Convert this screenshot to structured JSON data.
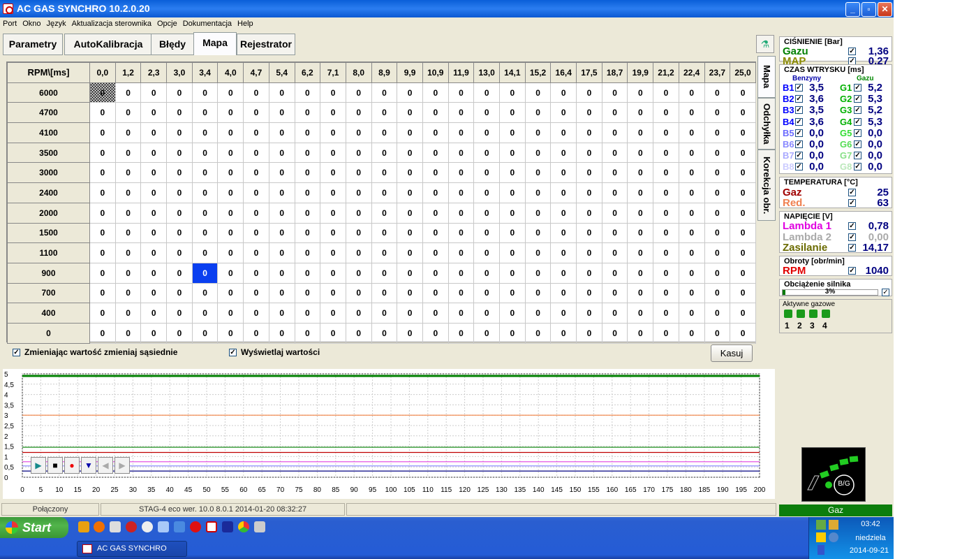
{
  "window": {
    "title": "AC GAS SYNCHRO  10.2.0.20",
    "minimize": "_",
    "maximize": "▫",
    "close": "✕"
  },
  "menu": [
    "Port",
    "Okno",
    "Język",
    "Aktualizacja sterownika",
    "Opcje",
    "Dokumentacja",
    "Help"
  ],
  "tabs": [
    "Parametry",
    "AutoKalibracja",
    "Błędy",
    "Mapa",
    "Rejestrator"
  ],
  "active_tab": "Mapa",
  "side_tabs": [
    "Mapa",
    "Odchyłka",
    "Korekcja obr."
  ],
  "map": {
    "corner": "RPM\\[ms]",
    "columns": [
      "0,0",
      "1,2",
      "2,3",
      "3,0",
      "3,4",
      "4,0",
      "4,7",
      "5,4",
      "6,2",
      "7,1",
      "8,0",
      "8,9",
      "9,9",
      "10,9",
      "11,9",
      "13,0",
      "14,1",
      "15,2",
      "16,4",
      "17,5",
      "18,7",
      "19,9",
      "21,2",
      "22,4",
      "23,7",
      "25,0"
    ],
    "rows": [
      "6000",
      "4700",
      "4100",
      "3500",
      "3000",
      "2400",
      "2000",
      "1500",
      "1100",
      "900",
      "700",
      "400",
      "0"
    ],
    "value": "0",
    "selected": {
      "row": 9,
      "col": 4
    },
    "hatched": {
      "row": 0,
      "col": 0
    }
  },
  "options": {
    "change_neighbors": "Zmieniając wartość zmieniaj sąsiednie",
    "show_values": "Wyświetlaj wartości",
    "clear": "Kasuj",
    "check": "✓"
  },
  "chart": {
    "y_ticks": [
      "5",
      "4,5",
      "4",
      "3,5",
      "3",
      "2,5",
      "2",
      "1,5",
      "1",
      "0,5",
      "0"
    ],
    "x_ticks": [
      "0",
      "5",
      "10",
      "15",
      "20",
      "25",
      "30",
      "35",
      "40",
      "45",
      "50",
      "55",
      "60",
      "65",
      "70",
      "75",
      "80",
      "85",
      "90",
      "95",
      "100",
      "105",
      "110",
      "115",
      "120",
      "125",
      "130",
      "135",
      "140",
      "145",
      "150",
      "155",
      "160",
      "165",
      "170",
      "175",
      "180",
      "185",
      "190",
      "195",
      "200"
    ],
    "series_colors": [
      "#008000",
      "#f08040",
      "#008000",
      "#c00000",
      "#e040e0",
      "#9090ff",
      "#000080"
    ],
    "series_levels": [
      4.9,
      3.0,
      1.45,
      1.2,
      0.75,
      0.55,
      0.3
    ]
  },
  "chart_controls": {
    "play": "▶",
    "stop": "■",
    "record": "●",
    "down": "▼",
    "prev": "◀",
    "next": "▶"
  },
  "status": {
    "connection": "Połączony",
    "device": "STAG-4 eco   wer. 10.0  8.0.1    2014-01-20 08:32:27"
  },
  "pressure": {
    "title": "CIŚNIENIE  [Bar]",
    "gas_label": "Gazu",
    "gas_value": "1,36",
    "map_label": "MAP",
    "map_value": "0,27"
  },
  "injection": {
    "title": "CZAS WTRYSKU  [ms]",
    "petrol_header": "Benzyny",
    "gas_header": "Gazu",
    "petrol": [
      {
        "l": "B1",
        "v": "3,5"
      },
      {
        "l": "B2",
        "v": "3,6"
      },
      {
        "l": "B3",
        "v": "3,5"
      },
      {
        "l": "B4",
        "v": "3,6"
      },
      {
        "l": "B5",
        "v": "0,0"
      },
      {
        "l": "B6",
        "v": "0,0"
      },
      {
        "l": "B7",
        "v": "0,0"
      },
      {
        "l": "B8",
        "v": "0,0"
      }
    ],
    "gas": [
      {
        "l": "G1",
        "v": "5,2"
      },
      {
        "l": "G2",
        "v": "5,3"
      },
      {
        "l": "G3",
        "v": "5,2"
      },
      {
        "l": "G4",
        "v": "5,3"
      },
      {
        "l": "G5",
        "v": "0,0"
      },
      {
        "l": "G6",
        "v": "0,0"
      },
      {
        "l": "G7",
        "v": "0,0"
      },
      {
        "l": "G8",
        "v": "0,0"
      }
    ]
  },
  "temperature": {
    "title": "TEMPERATURA  [°C]",
    "gas_label": "Gaz",
    "gas_value": "25",
    "red_label": "Red.",
    "red_value": "63"
  },
  "voltage": {
    "title": "NAPIĘCIE [V]",
    "l1_label": "Lambda 1",
    "l1_value": "0,78",
    "l2_label": "Lambda 2",
    "l2_value": "0,00",
    "sup_label": "Zasilanie",
    "sup_value": "14,17"
  },
  "rpm": {
    "title": "Obroty [obr/min]",
    "label": "RPM",
    "value": "1040"
  },
  "load": {
    "title": "Obciążenie silnika",
    "value": "3%",
    "fraction": 0.03
  },
  "active_gas": {
    "title": "Aktywne gazowe",
    "items": [
      "1",
      "2",
      "3",
      "4"
    ]
  },
  "mode": {
    "indicator": "B/G",
    "bar": "Gaz"
  },
  "taskbar": {
    "start": "Start",
    "window_button": "AC GAS SYNCHRO",
    "time": "03:42",
    "day": "niedziela",
    "date": "2014-09-21"
  }
}
